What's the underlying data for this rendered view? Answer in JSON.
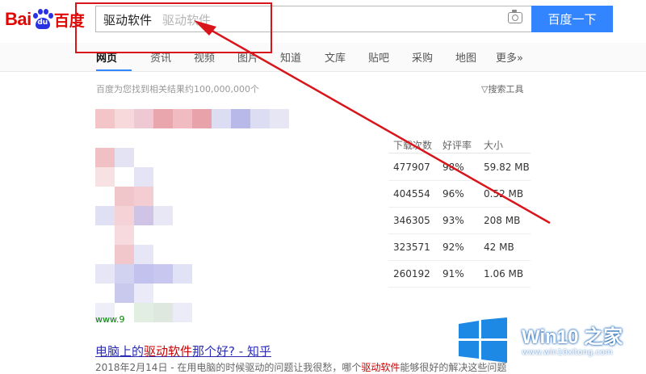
{
  "header": {
    "logo_text_latin": "Bai",
    "logo_paw_text": "du",
    "logo_text_cn": "百度",
    "search_query": "驱动软件",
    "search_suggestion": "驱动软件",
    "search_button": "百度一下",
    "camera_icon": "camera-icon"
  },
  "tabs": [
    "网页",
    "资讯",
    "视频",
    "图片",
    "知道",
    "文库",
    "贴吧",
    "采购",
    "地图",
    "更多»"
  ],
  "active_tab": "网页",
  "result_count": "百度为您找到相关结果约100,000,000个",
  "search_tools": "搜索工具",
  "download_table": {
    "headers": [
      "下载次数",
      "好评率",
      "大小"
    ],
    "rows": [
      [
        "477907",
        "98%",
        "59.82 MB"
      ],
      [
        "404554",
        "96%",
        "0.52 MB"
      ],
      [
        "346305",
        "93%",
        "208 MB"
      ],
      [
        "323571",
        "92%",
        "42 MB"
      ],
      [
        "260192",
        "91%",
        "1.06 MB"
      ]
    ]
  },
  "partial_url": "www.9",
  "result": {
    "title_pre": "电脑上的",
    "title_hl": "驱动软件",
    "title_post": "那个好? - 知乎",
    "snippet_pre": "2018年2月14日 - 在用电脑的时候驱动的问题让我很愁，哪个",
    "snippet_hl": "驱动软件",
    "snippet_post": "能够很好的解决这些问题"
  },
  "watermark": {
    "title": "Win10 之家",
    "url": "www.win10xitong.com"
  },
  "colors": {
    "accent_blue": "#3385ff",
    "annotation_red": "#d9151c",
    "baidu_red": "#e10601",
    "baidu_blue": "#2932e1"
  }
}
